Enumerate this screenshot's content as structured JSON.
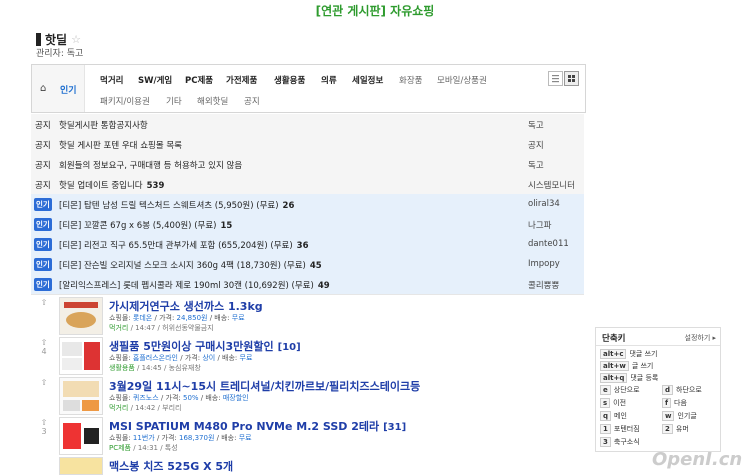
{
  "top_link": "[연관 게시판] 자유쇼핑",
  "board": {
    "title": "핫딜",
    "admin": "관리자: 독고"
  },
  "categories": {
    "popular": "인기",
    "row1": [
      "먹거리",
      "SW/게임",
      "PC제품",
      "가전제품",
      "생활용품",
      "의류",
      "세일정보",
      "화장품",
      "모바일/상품권"
    ],
    "row2": [
      "패키지/이용권",
      "기타",
      "해외핫딜",
      "공지"
    ]
  },
  "notices": [
    {
      "tag": "공지",
      "title": "핫딜게시판 통합공지사항",
      "count": "",
      "author": "독고"
    },
    {
      "tag": "공지",
      "title": "핫딜 게시판 포텐 우대 쇼핑몰 목록",
      "count": "",
      "author": "공지"
    },
    {
      "tag": "공지",
      "title": "회원들의 정보요구, 구매대행 등 허용하고 있지 않음",
      "count": "",
      "author": "독고"
    },
    {
      "tag": "공지",
      "title": "핫딜 업데이트 중입니다",
      "count": "539",
      "author": "시스템모니터"
    }
  ],
  "hot": [
    {
      "tag": "인기",
      "title": "[티몬] 탑텐 남성 드릴 텍스처드 스웨트셔츠 (5,950원) (무료)",
      "count": "26",
      "author": "oliral34"
    },
    {
      "tag": "인기",
      "title": "[티몬] 꼬깔콘 67g x 6봉 (5,400원) (무료)",
      "count": "15",
      "author": "나그파"
    },
    {
      "tag": "인기",
      "title": "[티몬] 리전고 직구 65.5만대 관부가세 포함 (655,204원) (무료)",
      "count": "36",
      "author": "dante011"
    },
    {
      "tag": "인기",
      "title": "[티몬] 잔슨빌 오리지널 스모크 소시지 360g 4팩 (18,730원) (무료)",
      "count": "45",
      "author": "Impopy"
    },
    {
      "tag": "인기",
      "title": "[알리익스프레스] 롯데 펩시콜라 제로 190ml 30캔 (10,692원) (무료)",
      "count": "49",
      "author": "콜리뿡뿡"
    }
  ],
  "posts": [
    {
      "votes": "",
      "title": "가시제거연구소 생선까스 1.3kg",
      "comments": "",
      "mall_label": "쇼핑몰:",
      "mall": "롯데온",
      "price_label": "/ 가격:",
      "price": "24,850원",
      "ship_label": "/ 배송:",
      "ship": "무료",
      "category": "먹거리",
      "time": "/ 14:47 / 허위선동약물금지"
    },
    {
      "votes": "4",
      "title": "생필품 5만원이상 구매시3만원할인",
      "comments": "[10]",
      "mall_label": "쇼핑몰:",
      "mall": "홈플러스온라인",
      "price_label": "/ 가격:",
      "price": "상이",
      "ship_label": "/ 배송:",
      "ship": "무료",
      "category": "생활용품",
      "time": "/ 14:45 / 농심유재창"
    },
    {
      "votes": "",
      "title": "3월29일 11시~15시 트레디셔널/치킨까르보/필리치즈스테이크등",
      "comments": "",
      "mall_label": "쇼핑몰:",
      "mall": "퀴즈노스",
      "price_label": "/ 가격:",
      "price": "50%",
      "ship_label": "/ 배송:",
      "ship": "매장할인",
      "category": "먹거리",
      "time": "/ 14:42 / 부리리"
    },
    {
      "votes": "3",
      "title": "MSI SPATIUM M480 Pro NVMe M.2 SSD 2테라",
      "comments": "[31]",
      "mall_label": "쇼핑몰:",
      "mall": "11번가",
      "price_label": "/ 가격:",
      "price": "168,370원",
      "ship_label": "/ 배송:",
      "ship": "무료",
      "category": "PC제품",
      "time": "/ 14:31 / 톡성"
    },
    {
      "votes": "",
      "title": "맥스봉 치즈 525G X 5개",
      "comments": "",
      "mall_label": "",
      "mall": "",
      "price_label": "",
      "price": "",
      "ship_label": "",
      "ship": "",
      "category": "",
      "time": ""
    }
  ],
  "shortcuts": {
    "title": "단축키",
    "settings": "설정하기 ▸",
    "items": [
      {
        "key": "alt+c",
        "label": "댓글 쓰기"
      },
      {
        "key": "alt+w",
        "label": "글 쓰기"
      },
      {
        "key": "alt+q",
        "label": "댓글 등록"
      },
      {
        "key": "e",
        "label": "상단으로"
      },
      {
        "key": "d",
        "label": "하단으로"
      },
      {
        "key": "s",
        "label": "이전"
      },
      {
        "key": "f",
        "label": "다음"
      },
      {
        "key": "q",
        "label": "메인"
      },
      {
        "key": "w",
        "label": "인기글"
      },
      {
        "key": "1",
        "label": "포텐터짐"
      },
      {
        "key": "2",
        "label": "유머"
      },
      {
        "key": "3",
        "label": "축구소식"
      }
    ]
  },
  "watermark": "OpenI.cn",
  "colors": {
    "accent": "#2c6cd6",
    "board_link": "#2e9b2e",
    "hot_row": "#e6f0fb",
    "post_title": "#1f3ea8"
  }
}
